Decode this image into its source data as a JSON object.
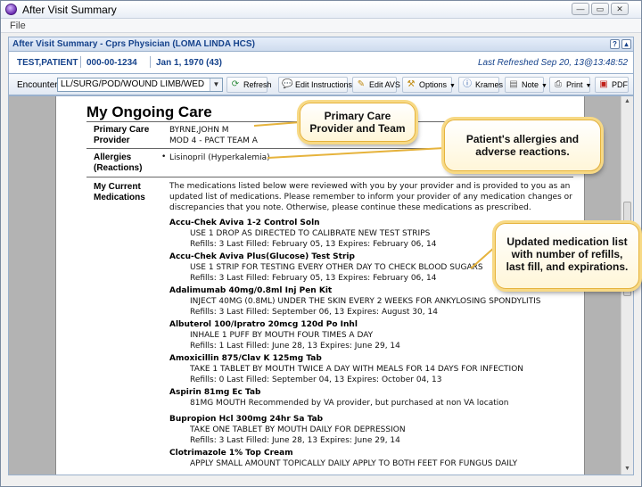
{
  "window": {
    "title": "After Visit Summary",
    "menu_file": "File",
    "btn_minimize": "—",
    "btn_restore": "▭",
    "btn_close": "✕"
  },
  "panel": {
    "title": "After Visit Summary - Cprs Physician (LOMA LINDA HCS)",
    "help": "?",
    "collapse": "▴"
  },
  "patient": {
    "name": "TEST,PATIENT",
    "id": "000-00-1234",
    "dob": "Jan 1, 1970 (43)",
    "last_refreshed": "Last Refreshed Sep 20, 13@13:48:52"
  },
  "toolbar": {
    "encounter_label": "Encounter:",
    "encounter_value": "LL/SURG/POD/WOUND LIMB/WED",
    "refresh": "Refresh",
    "edit_instructions": "Edit Instructions",
    "edit_avs": "Edit AVS",
    "options": "Options",
    "krames": "Krames",
    "note": "Note",
    "print": "Print",
    "pdf": "PDF"
  },
  "doc": {
    "heading": "My Ongoing Care",
    "pcp_label_1": "Primary Care",
    "pcp_label_2": "Provider",
    "pcp_name": "BYRNE,JOHN M",
    "pcp_team": "MOD 4 - PACT TEAM A",
    "allergies_label_1": "Allergies",
    "allergies_label_2": "(Reactions)",
    "allergy_item": "Lisinopril (Hyperkalemia)",
    "meds_label_1": "My Current",
    "meds_label_2": "Medications",
    "meds_intro_1": "The medications listed below were reviewed with you by your provider and is provided to you as an",
    "meds_intro_2": "updated list of medications. Please remember to inform your provider of any medication changes or",
    "meds_intro_3": "discrepancies that you note. Otherwise, please continue these medications as prescribed.",
    "medications": [
      {
        "name": "Accu-Chek Aviva 1-2 Control Soln",
        "sig": "USE 1 DROP AS DIRECTED TO CALIBRATE NEW TEST STRIPS",
        "fill": "Refills: 3   Last Filled: February 05, 13   Expires: February 06, 14"
      },
      {
        "name": "Accu-Chek Aviva Plus(Glucose) Test Strip",
        "sig": "USE 1 STRIP FOR TESTING EVERY OTHER DAY TO CHECK BLOOD SUGARS",
        "fill": "Refills: 3   Last Filled: February 05, 13   Expires: February 06, 14"
      },
      {
        "name": "Adalimumab 40mg/0.8ml Inj Pen Kit",
        "sig": "INJECT 40MG (0.8ML) UNDER THE SKIN EVERY 2 WEEKS FOR ANKYLOSING SPONDYLITIS",
        "fill": "Refills: 3   Last Filled: September 06, 13   Expires: August 30, 14"
      },
      {
        "name": "Albuterol 100/Ipratro 20mcg 120d Po Inhl",
        "sig": "INHALE 1 PUFF BY MOUTH FOUR TIMES A DAY",
        "fill": "Refills: 1   Last Filled: June 28, 13   Expires: June 29, 14"
      },
      {
        "name": "Amoxicillin 875/Clav K 125mg Tab",
        "sig": "TAKE 1 TABLET BY MOUTH TWICE A DAY WITH MEALS FOR 14 DAYS FOR INFECTION",
        "fill": "Refills: 0   Last Filled: September 04, 13   Expires: October 04, 13"
      },
      {
        "name": "Aspirin 81mg Ec Tab",
        "sig": "81MG MOUTH Recommended by VA provider, but purchased at non VA location",
        "fill": ""
      },
      {
        "name": "Bupropion Hcl 300mg 24hr Sa Tab",
        "sig": "TAKE ONE TABLET BY MOUTH DAILY FOR DEPRESSION",
        "fill": "Refills: 3   Last Filled: June 28, 13   Expires: June 29, 14"
      },
      {
        "name": "Clotrimazole 1% Top Cream",
        "sig": "APPLY SMALL AMOUNT TOPICALLY DAILY APPLY TO BOTH FEET FOR FUNGUS DAILY",
        "fill": ""
      }
    ]
  },
  "callouts": {
    "pcp_1": "Primary Care",
    "pcp_2": "Provider and Team",
    "allergy_1": "Patient's allergies and",
    "allergy_2": "adverse reactions.",
    "meds_1": "Updated medication list",
    "meds_2": "with number of refills,",
    "meds_3": "last fill, and expirations."
  },
  "colors": {
    "panel_title": "#15428b",
    "callout_border": "#e6b33c",
    "doc_background": "#b3b3b3"
  }
}
